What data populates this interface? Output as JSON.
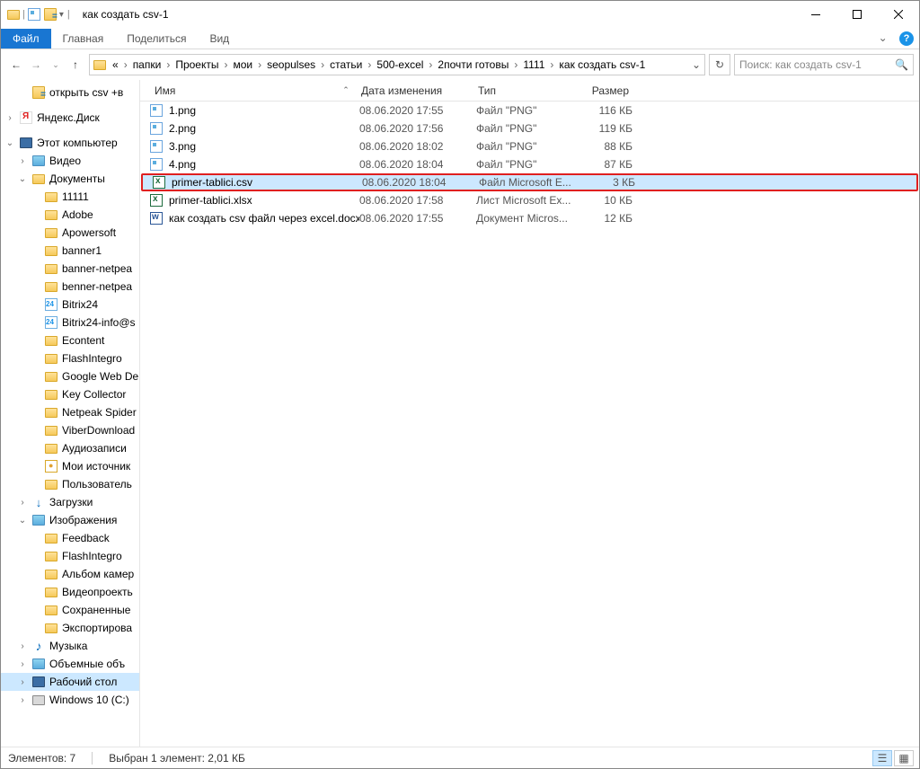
{
  "window_title": "как создать csv-1",
  "tabs": {
    "file": "Файл",
    "home": "Главная",
    "share": "Поделиться",
    "view": "Вид"
  },
  "breadcrumb": {
    "prefix": "«",
    "items": [
      "папки",
      "Проекты",
      "мои",
      "seopulses",
      "статьи",
      "500-excel",
      "2почти готовы",
      "1111",
      "как создать csv-1"
    ]
  },
  "search_placeholder": "Поиск: как создать csv-1",
  "sidebar": [
    {
      "indent": 1,
      "icon": "eq",
      "label": "открыть csv +в",
      "expand": ""
    },
    {
      "spacer": true
    },
    {
      "indent": 0,
      "icon": "ya",
      "label": "Яндекс.Диск",
      "expand": ">"
    },
    {
      "spacer": true
    },
    {
      "indent": 0,
      "icon": "comp",
      "label": "Этот компьютер",
      "expand": "v"
    },
    {
      "indent": 1,
      "icon": "pic",
      "label": "Видео",
      "expand": ">"
    },
    {
      "indent": 1,
      "icon": "folder",
      "label": "Документы",
      "expand": "v"
    },
    {
      "indent": 2,
      "icon": "folder",
      "label": "11111",
      "expand": ""
    },
    {
      "indent": 2,
      "icon": "folder",
      "label": "Adobe",
      "expand": ""
    },
    {
      "indent": 2,
      "icon": "folder",
      "label": "Apowersoft",
      "expand": ""
    },
    {
      "indent": 2,
      "icon": "folder",
      "label": "banner1",
      "expand": ""
    },
    {
      "indent": 2,
      "icon": "folder",
      "label": "banner-netpea",
      "expand": ""
    },
    {
      "indent": 2,
      "icon": "folder",
      "label": "benner-netpea",
      "expand": ""
    },
    {
      "indent": 2,
      "icon": "b24",
      "label": "Bitrix24",
      "expand": ""
    },
    {
      "indent": 2,
      "icon": "b24",
      "label": "Bitrix24-info@s",
      "expand": ""
    },
    {
      "indent": 2,
      "icon": "folder",
      "label": "Econtent",
      "expand": ""
    },
    {
      "indent": 2,
      "icon": "folder",
      "label": "FlashIntegro",
      "expand": ""
    },
    {
      "indent": 2,
      "icon": "folder",
      "label": "Google Web De",
      "expand": ""
    },
    {
      "indent": 2,
      "icon": "folder",
      "label": "Key Collector",
      "expand": ""
    },
    {
      "indent": 2,
      "icon": "folder",
      "label": "Netpeak Spider",
      "expand": ""
    },
    {
      "indent": 2,
      "icon": "folder",
      "label": "ViberDownload",
      "expand": ""
    },
    {
      "indent": 2,
      "icon": "folder",
      "label": "Аудиозаписи",
      "expand": ""
    },
    {
      "indent": 2,
      "icon": "src",
      "label": "Мои источник",
      "expand": ""
    },
    {
      "indent": 2,
      "icon": "folder",
      "label": "Пользователь",
      "expand": ""
    },
    {
      "indent": 1,
      "icon": "dl",
      "label": "Загрузки",
      "expand": ">"
    },
    {
      "indent": 1,
      "icon": "pic",
      "label": "Изображения",
      "expand": "v"
    },
    {
      "indent": 2,
      "icon": "folder",
      "label": "Feedback",
      "expand": ""
    },
    {
      "indent": 2,
      "icon": "folder",
      "label": "FlashIntegro",
      "expand": ""
    },
    {
      "indent": 2,
      "icon": "folder",
      "label": "Альбом камер",
      "expand": ""
    },
    {
      "indent": 2,
      "icon": "folder",
      "label": "Видеопроекть",
      "expand": ""
    },
    {
      "indent": 2,
      "icon": "folder",
      "label": "Сохраненные",
      "expand": ""
    },
    {
      "indent": 2,
      "icon": "folder",
      "label": "Экспортирова",
      "expand": ""
    },
    {
      "indent": 1,
      "icon": "music",
      "label": "Музыка",
      "expand": ">"
    },
    {
      "indent": 1,
      "icon": "pic",
      "label": "Объемные объ",
      "expand": ">"
    },
    {
      "indent": 1,
      "icon": "comp",
      "label": "Рабочий стол",
      "expand": ">",
      "selected": true
    },
    {
      "indent": 1,
      "icon": "disk",
      "label": "Windows 10 (C:)",
      "expand": ">"
    }
  ],
  "columns": {
    "name": "Имя",
    "date": "Дата изменения",
    "type": "Тип",
    "size": "Размер"
  },
  "files": [
    {
      "icon": "png",
      "name": "1.png",
      "date": "08.06.2020 17:55",
      "type": "Файл \"PNG\"",
      "size": "116 КБ"
    },
    {
      "icon": "png",
      "name": "2.png",
      "date": "08.06.2020 17:56",
      "type": "Файл \"PNG\"",
      "size": "119 КБ"
    },
    {
      "icon": "png",
      "name": "3.png",
      "date": "08.06.2020 18:02",
      "type": "Файл \"PNG\"",
      "size": "88 КБ"
    },
    {
      "icon": "png",
      "name": "4.png",
      "date": "08.06.2020 18:04",
      "type": "Файл \"PNG\"",
      "size": "87 КБ"
    },
    {
      "icon": "excel",
      "name": "primer-tablici.csv",
      "date": "08.06.2020 18:04",
      "type": "Файл Microsoft E...",
      "size": "3 КБ",
      "selected": true,
      "highlighted": true
    },
    {
      "icon": "excel",
      "name": "primer-tablici.xlsx",
      "date": "08.06.2020 17:58",
      "type": "Лист Microsoft Ex...",
      "size": "10 КБ"
    },
    {
      "icon": "word",
      "name": "как создать csv файл через excel.docx",
      "date": "08.06.2020 17:55",
      "type": "Документ Micros...",
      "size": "12 КБ"
    }
  ],
  "statusbar": {
    "count": "Элементов: 7",
    "selection": "Выбран 1 элемент: 2,01 КБ"
  }
}
